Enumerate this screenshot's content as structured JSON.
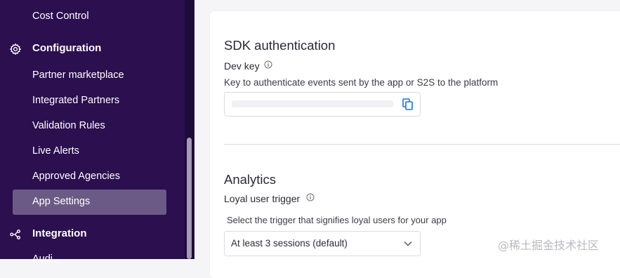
{
  "sidebar": {
    "items": [
      {
        "label": "Cost Control"
      },
      {
        "label": "Configuration",
        "icon": "gear-icon"
      },
      {
        "label": "Partner marketplace"
      },
      {
        "label": "Integrated Partners"
      },
      {
        "label": "Validation Rules"
      },
      {
        "label": "Live Alerts"
      },
      {
        "label": "Approved Agencies"
      },
      {
        "label": "App Settings",
        "active": true
      },
      {
        "label": "Integration",
        "icon": "integration-icon"
      },
      {
        "label": "Audi..."
      }
    ]
  },
  "sdk": {
    "title": "SDK authentication",
    "dev_key_label": "Dev key",
    "description": "Key to authenticate events sent by the app or S2S to the platform"
  },
  "analytics": {
    "title": "Analytics",
    "loyal_label": "Loyal user trigger",
    "loyal_description": "Select the trigger that signifies loyal users for your app",
    "loyal_value": "At least 3 sessions (default)"
  },
  "watermark": "@稀土掘金技术社区",
  "colors": {
    "sidebar_bg": "#2b0f4f",
    "active_bg": "#6b5a85",
    "text": "#2b2b38"
  }
}
